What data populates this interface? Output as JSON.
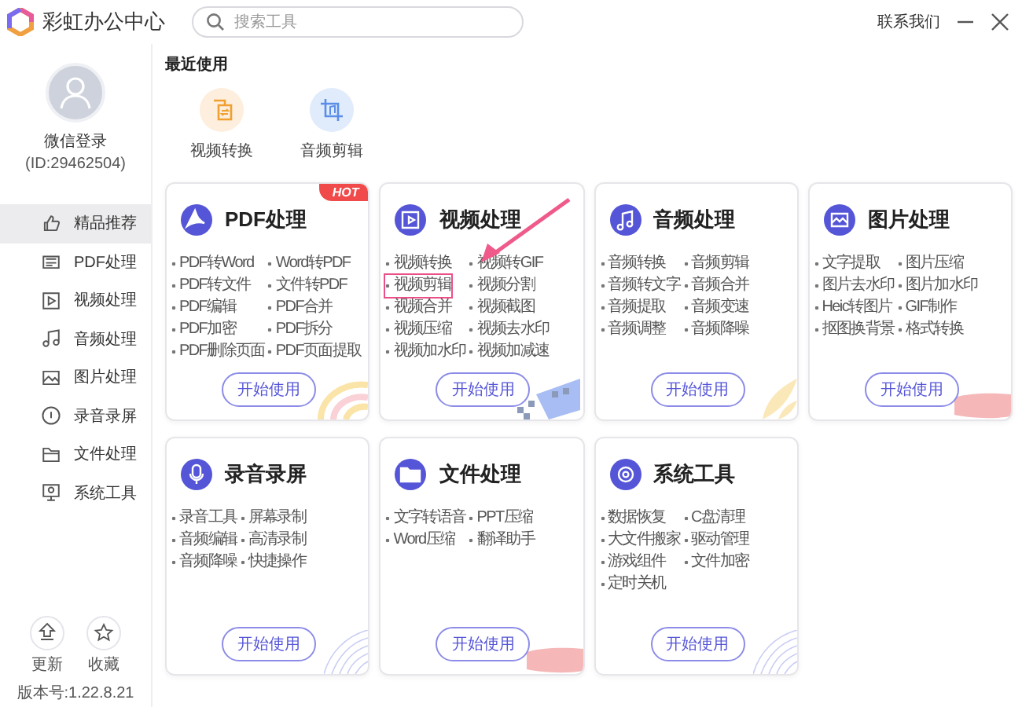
{
  "app": {
    "name": "彩虹办公中心"
  },
  "search": {
    "placeholder": "搜索工具"
  },
  "contact": "联系我们",
  "user": {
    "name": "微信登录",
    "id": "(ID:29462504)"
  },
  "sidebar": {
    "items": [
      {
        "label": "精品推荐",
        "kind": "thumb",
        "selected": true
      },
      {
        "label": "PDF处理",
        "kind": "pdf",
        "selected": false
      },
      {
        "label": "视频处理",
        "kind": "video",
        "selected": false
      },
      {
        "label": "音频处理",
        "kind": "music",
        "selected": false
      },
      {
        "label": "图片处理",
        "kind": "image",
        "selected": false
      },
      {
        "label": "录音录屏",
        "kind": "record",
        "selected": false
      },
      {
        "label": "文件处理",
        "kind": "folder",
        "selected": false
      },
      {
        "label": "系统工具",
        "kind": "system",
        "selected": false
      }
    ]
  },
  "bottom_actions": [
    {
      "label": "更新",
      "kind": "update"
    },
    {
      "label": "收藏",
      "kind": "star"
    }
  ],
  "version": "版本号:1.22.8.21",
  "recent": {
    "title": "最近使用",
    "items": [
      {
        "label": "视频转换",
        "kind": "convert"
      },
      {
        "label": "音频剪辑",
        "kind": "crop"
      }
    ]
  },
  "cards": [
    {
      "title": "PDF处理",
      "kind": "pdf",
      "badge": "HOT",
      "button": "开始使用",
      "items": [
        {
          "label": "PDF转Word",
          "highlighted": false
        },
        {
          "label": "Word转PDF",
          "highlighted": false
        },
        {
          "label": "PDF转文件",
          "highlighted": false
        },
        {
          "label": "文件转PDF",
          "highlighted": false
        },
        {
          "label": "PDF编辑",
          "highlighted": false
        },
        {
          "label": "PDF合并",
          "highlighted": false
        },
        {
          "label": "PDF加密",
          "highlighted": false
        },
        {
          "label": "PDF拆分",
          "highlighted": false
        },
        {
          "label": "PDF删除页面",
          "highlighted": false
        },
        {
          "label": "PDF页面提取",
          "highlighted": false
        }
      ]
    },
    {
      "title": "视频处理",
      "kind": "video",
      "button": "开始使用",
      "items": [
        {
          "label": "视频转换",
          "highlighted": false
        },
        {
          "label": "视频转GIF",
          "highlighted": false
        },
        {
          "label": "视频剪辑",
          "highlighted": true
        },
        {
          "label": "视频分割",
          "highlighted": false
        },
        {
          "label": "视频合并",
          "highlighted": false
        },
        {
          "label": "视频截图",
          "highlighted": false
        },
        {
          "label": "视频压缩",
          "highlighted": false
        },
        {
          "label": "视频去水印",
          "highlighted": false
        },
        {
          "label": "视频加水印",
          "highlighted": false
        },
        {
          "label": "视频加减速",
          "highlighted": false
        }
      ]
    },
    {
      "title": "音频处理",
      "kind": "music",
      "button": "开始使用",
      "items": [
        {
          "label": "音频转换",
          "highlighted": false
        },
        {
          "label": "音频剪辑",
          "highlighted": false
        },
        {
          "label": "音频转文字",
          "highlighted": false
        },
        {
          "label": "音频合并",
          "highlighted": false
        },
        {
          "label": "音频提取",
          "highlighted": false
        },
        {
          "label": "音频变速",
          "highlighted": false
        },
        {
          "label": "音频调整",
          "highlighted": false
        },
        {
          "label": "音频降噪",
          "highlighted": false
        }
      ]
    },
    {
      "title": "图片处理",
      "kind": "image",
      "button": "开始使用",
      "items": [
        {
          "label": "文字提取",
          "highlighted": false
        },
        {
          "label": "图片压缩",
          "highlighted": false
        },
        {
          "label": "图片去水印",
          "highlighted": false
        },
        {
          "label": "图片加水印",
          "highlighted": false
        },
        {
          "label": "Heic转图片",
          "highlighted": false
        },
        {
          "label": "GIF制作",
          "highlighted": false
        },
        {
          "label": "抠图换背景",
          "highlighted": false
        },
        {
          "label": "格式转换",
          "highlighted": false
        }
      ]
    },
    {
      "title": "录音录屏",
      "kind": "record",
      "button": "开始使用",
      "items": [
        {
          "label": "录音工具",
          "highlighted": false
        },
        {
          "label": "屏幕录制",
          "highlighted": false
        },
        {
          "label": "音频编辑",
          "highlighted": false
        },
        {
          "label": "高清录制",
          "highlighted": false
        },
        {
          "label": "音频降噪",
          "highlighted": false
        },
        {
          "label": "快捷操作",
          "highlighted": false
        }
      ]
    },
    {
      "title": "文件处理",
      "kind": "folder",
      "button": "开始使用",
      "items": [
        {
          "label": "文字转语音",
          "highlighted": false
        },
        {
          "label": "PPT压缩",
          "highlighted": false
        },
        {
          "label": "Word压缩",
          "highlighted": false
        },
        {
          "label": "翻译助手",
          "highlighted": false
        }
      ]
    },
    {
      "title": "系统工具",
      "kind": "system",
      "button": "开始使用",
      "items": [
        {
          "label": "数据恢复",
          "highlighted": false
        },
        {
          "label": "C盘清理",
          "highlighted": false
        },
        {
          "label": "大文件搬家",
          "highlighted": false
        },
        {
          "label": "驱动管理",
          "highlighted": false
        },
        {
          "label": "游戏组件",
          "highlighted": false
        },
        {
          "label": "文件加密",
          "highlighted": false
        },
        {
          "label": "定时关机",
          "highlighted": false
        }
      ]
    }
  ]
}
